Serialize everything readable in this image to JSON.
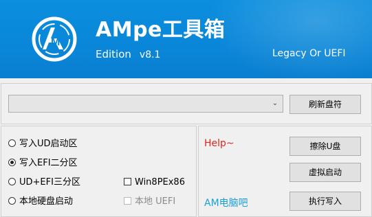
{
  "header": {
    "title": "AMpe工具箱",
    "edition_label": "Edition",
    "version": "v8.1",
    "mode": "Legacy Or UEFI",
    "colors": {
      "background": "#0a86d8",
      "text": "#ffffff"
    },
    "logo_icon": "am-logo-icon"
  },
  "disk": {
    "selected": "",
    "refresh_label": "刷新盘符"
  },
  "options": {
    "items": [
      {
        "label": "写入UD启动区",
        "selected": false
      },
      {
        "label": "写入EFI二分区",
        "selected": true
      },
      {
        "label": "UD+EFI三分区",
        "selected": false
      },
      {
        "label": "本地硬盘启动",
        "selected": false
      }
    ],
    "win8pe_label": "Win8PEx86",
    "local_uefi_label": "本地 UEFI"
  },
  "actions": {
    "help_link": "Help~",
    "forum_link": "AM电脑吧",
    "erase_label": "擦除U盘",
    "virtual_boot_label": "虚拟启动",
    "execute_label": "执行写入",
    "colors": {
      "help": "#e0241b",
      "forum": "#1aa0d8"
    }
  }
}
